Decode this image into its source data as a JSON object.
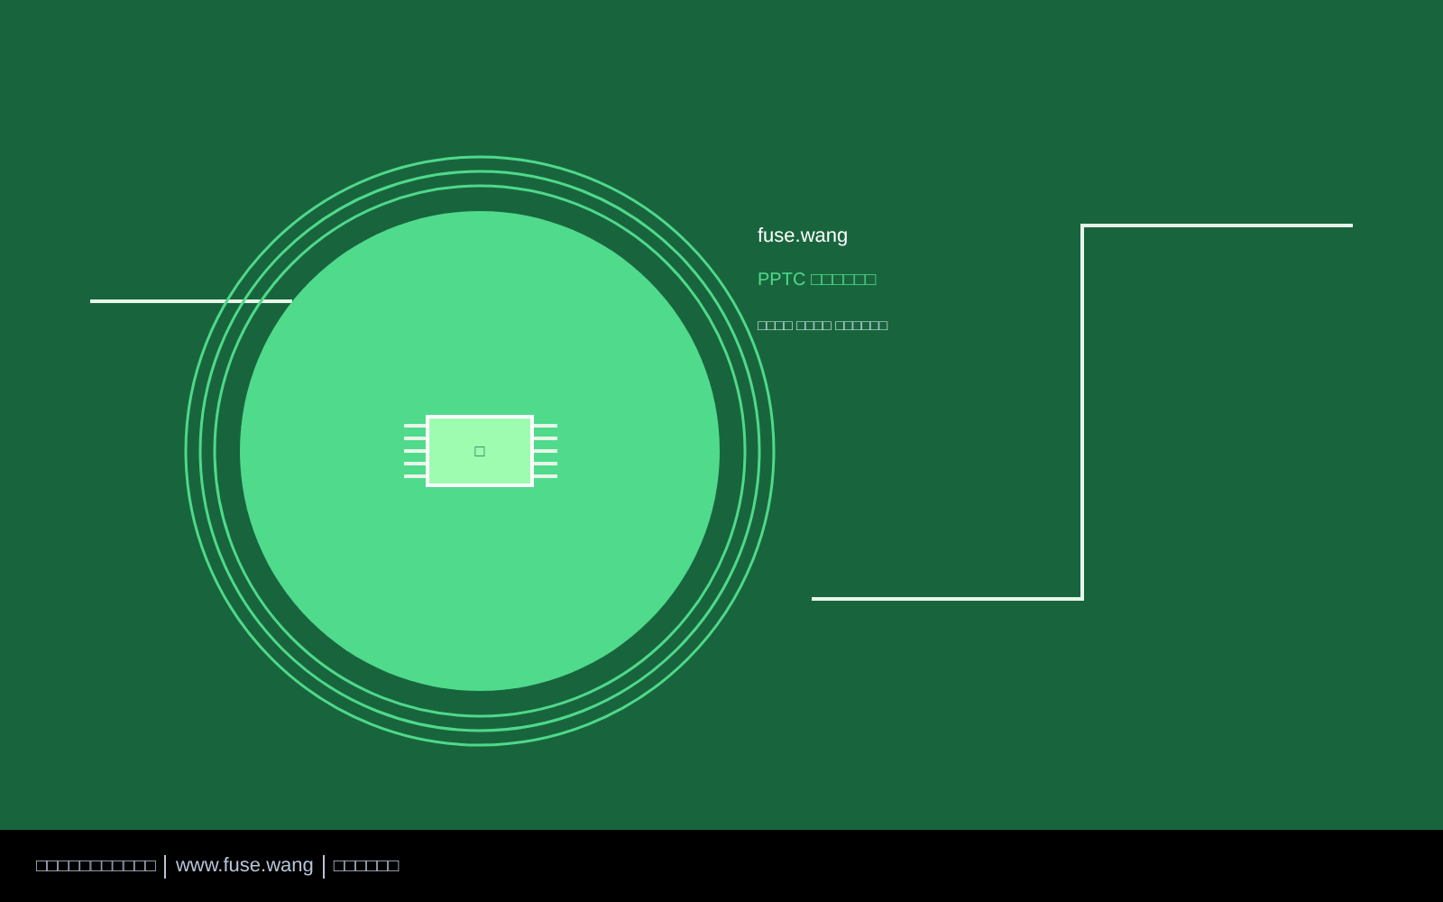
{
  "info": {
    "title": "fuse.wang",
    "subtitle": "PPTC □□□□□□",
    "tagline": "□□□□ □□□□ □□□□□□"
  },
  "chip": {
    "label": "□"
  },
  "footer": {
    "left": "□□□□□□□□□□□",
    "link": "www.fuse.wang",
    "right": "□□□□□□"
  }
}
